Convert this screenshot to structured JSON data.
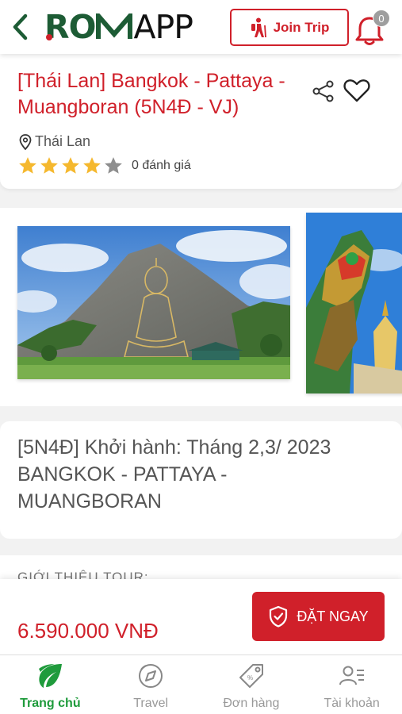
{
  "header": {
    "logo_left": "RO",
    "logo_right": "APP",
    "join_label": "Join Trip",
    "notification_count": "0"
  },
  "tour": {
    "title": "[Thái Lan] Bangkok - Pattaya - Muangboran (5N4Đ - VJ)",
    "location": "Thái Lan",
    "rating": 4,
    "rating_max": 5,
    "review_count": "0 đánh giá"
  },
  "gallery": {
    "images": [
      "buddha-mountain-photo",
      "temple-guardian-photo"
    ]
  },
  "details": {
    "line1": "[5N4Đ] Khởi hành: Tháng 2,3/ 2023",
    "line2": "BANGKOK - PATTAYA -",
    "line3": "MUANGBORAN"
  },
  "intro": {
    "label": "GIỚI THIỆU TOUR:"
  },
  "booking": {
    "price": "6.590.000 VNĐ",
    "book_label": "ĐẶT NGAY"
  },
  "nav": {
    "items": [
      {
        "label": "Trang chủ",
        "icon": "home-leaf-icon",
        "active": true
      },
      {
        "label": "Travel",
        "icon": "compass-icon",
        "active": false
      },
      {
        "label": "Đơn hàng",
        "icon": "tag-icon",
        "active": false
      },
      {
        "label": "Tài khoản",
        "icon": "account-icon",
        "active": false
      }
    ]
  },
  "colors": {
    "primary_red": "#d0202a",
    "brand_green": "#1d5c35",
    "active_green": "#1f9b3c",
    "star_gold": "#f5b82e"
  }
}
